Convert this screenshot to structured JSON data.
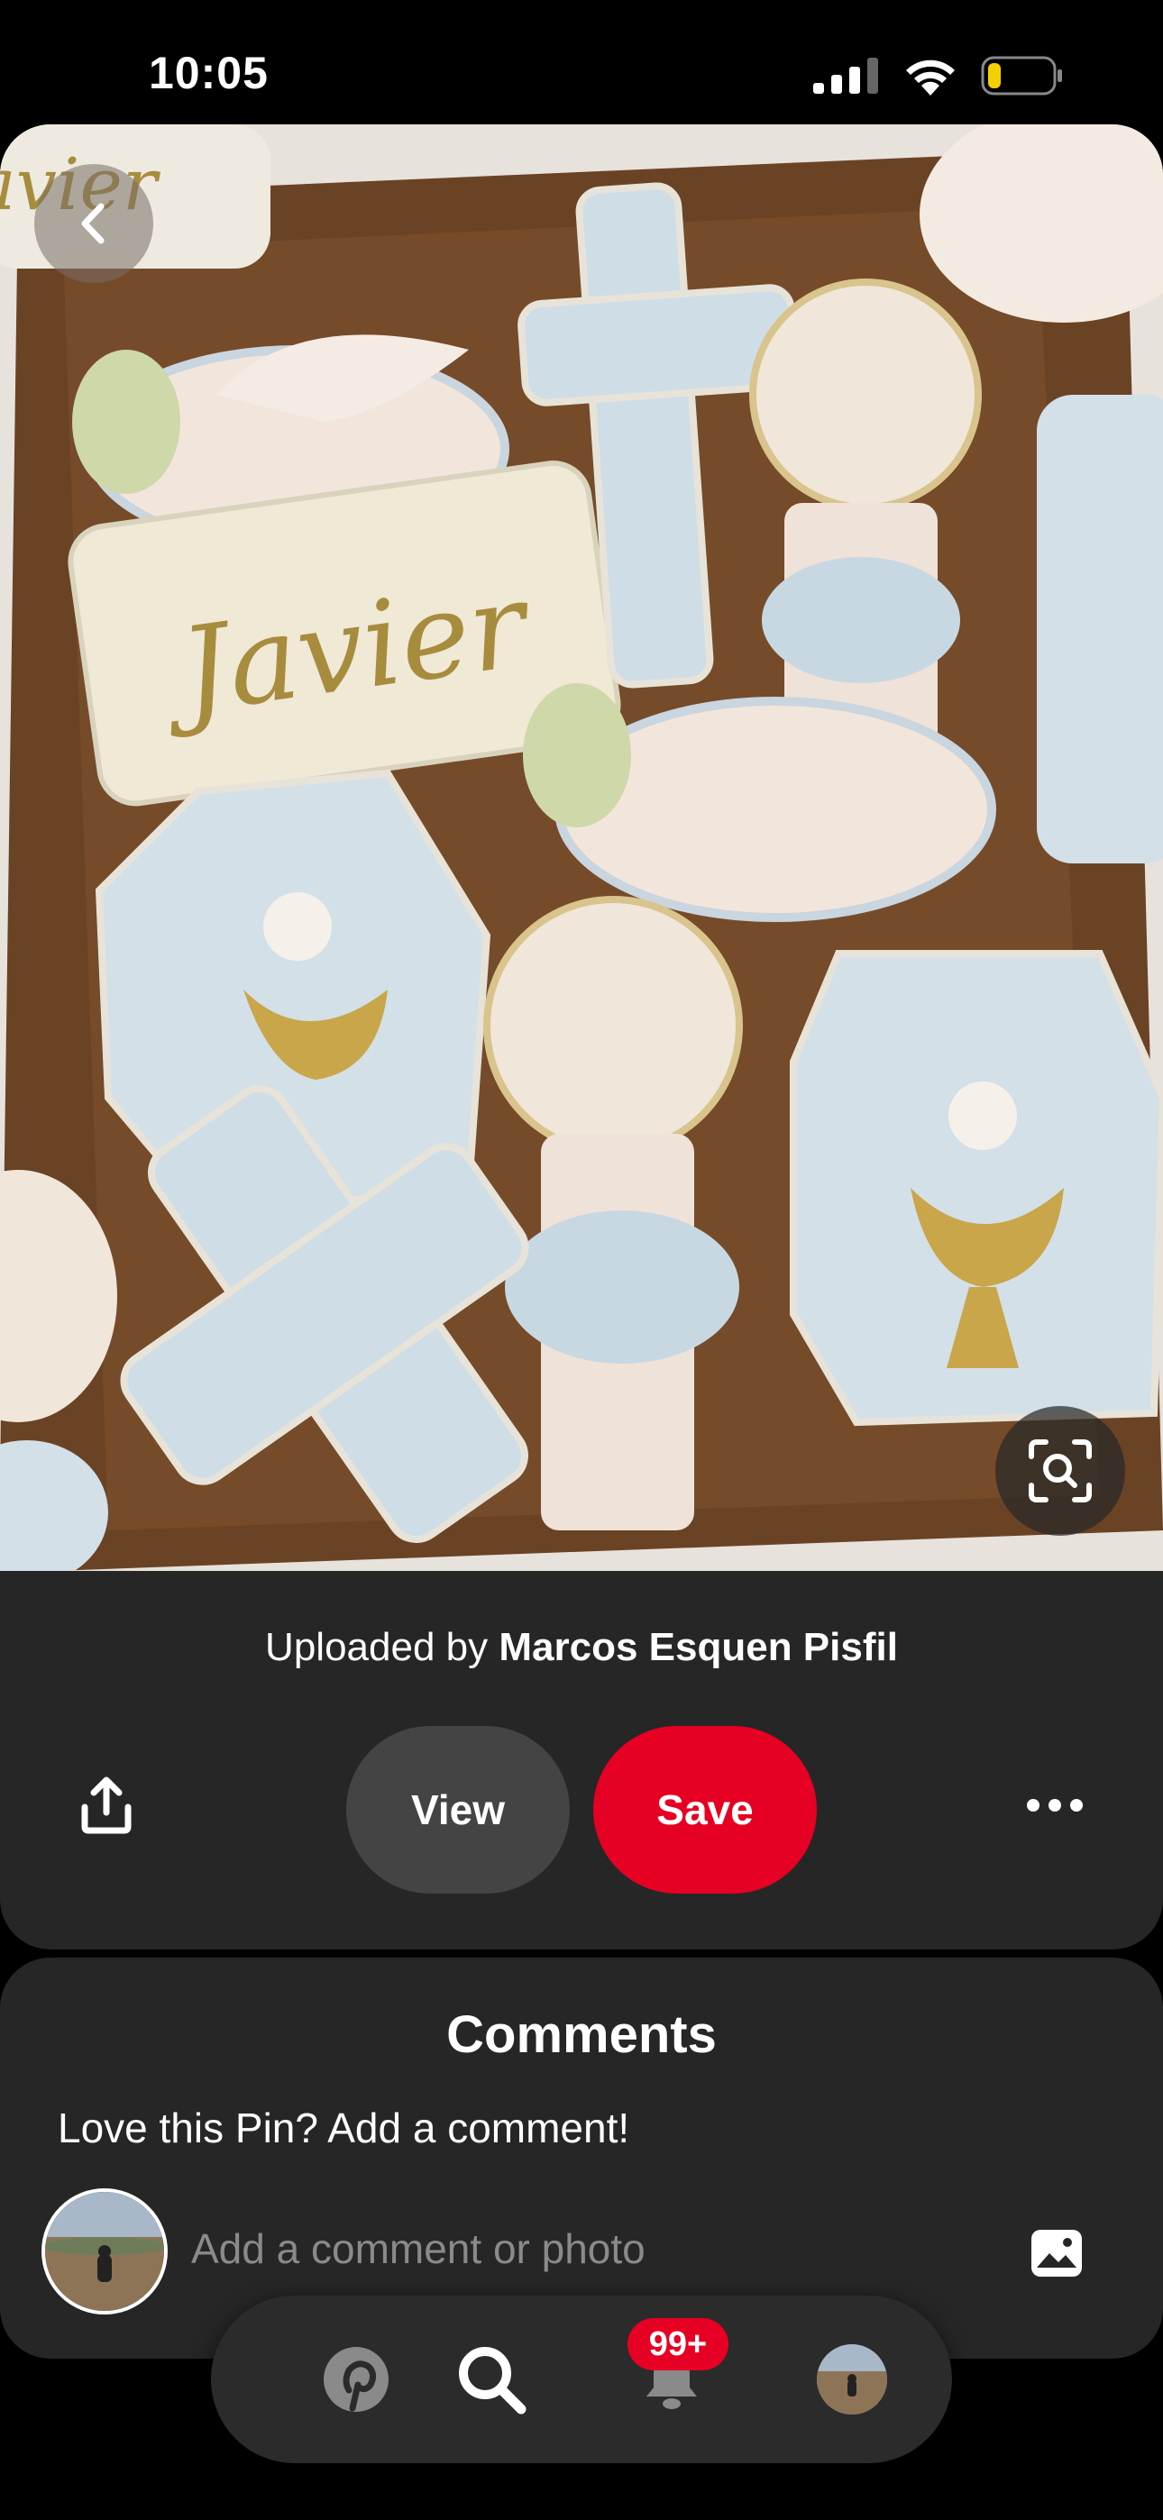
{
  "status_bar": {
    "time": "10:05",
    "battery_level": 0.2
  },
  "pin": {
    "uploaded_prefix": "Uploaded by",
    "uploader": "Marcos Esquen Pisfil",
    "view_label": "View",
    "save_label": "Save",
    "cookie_name": "Javier"
  },
  "comments": {
    "title": "Comments",
    "prompt": "Love this Pin? Add a comment!",
    "input_placeholder": "Add a comment or photo"
  },
  "tab_bar": {
    "notifications_badge": "99+"
  },
  "icons": [
    "chevron-left-icon",
    "visual-search-icon",
    "share-icon",
    "more-icon",
    "image-icon",
    "pinterest-icon",
    "search-icon",
    "bell-icon"
  ],
  "colors": {
    "save": "#e60023",
    "panel": "#262626",
    "view": "#444444",
    "background": "#000000"
  }
}
